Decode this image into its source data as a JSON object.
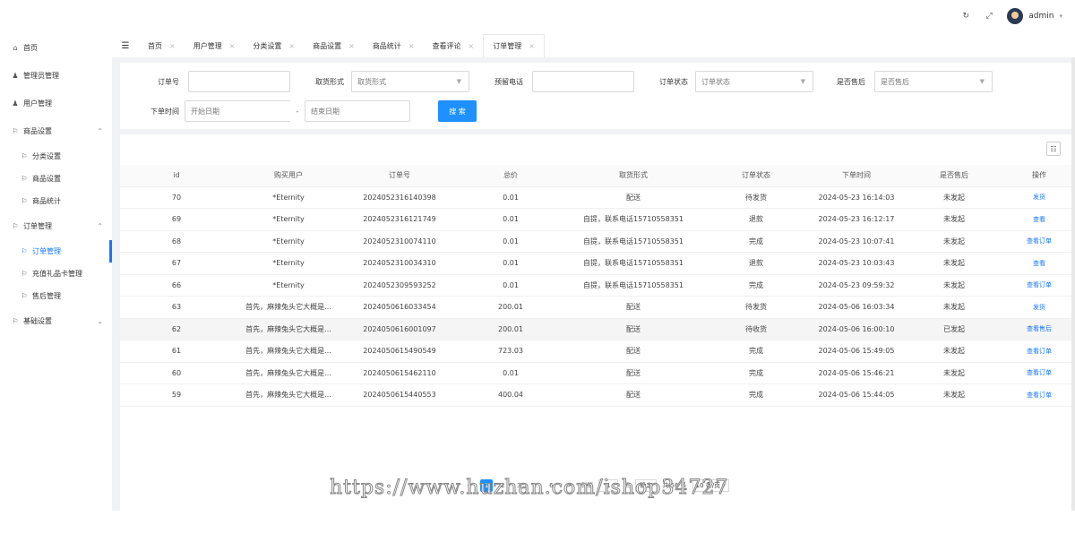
{
  "header": {
    "refresh_icon": "refresh-icon",
    "fullscreen_icon": "fullscreen-icon",
    "username": "admin"
  },
  "sidebar": {
    "items": [
      {
        "label": "首页",
        "icon": "home-icon"
      },
      {
        "label": "管理员管理",
        "icon": "users-icon"
      },
      {
        "label": "用户管理",
        "icon": "users-icon"
      },
      {
        "label": "商品设置",
        "icon": "flag-icon",
        "expanded": true
      },
      {
        "label": "分类设置",
        "icon": "flag-icon",
        "sub": true
      },
      {
        "label": "商品设置",
        "icon": "flag-icon",
        "sub": true
      },
      {
        "label": "商品统计",
        "icon": "flag-icon",
        "sub": true
      },
      {
        "label": "订单管理",
        "icon": "flag-icon",
        "expanded": true
      },
      {
        "label": "订单管理",
        "icon": "flag-icon",
        "sub": true,
        "active": true
      },
      {
        "label": "充值礼品卡管理",
        "icon": "flag-icon",
        "sub": true
      },
      {
        "label": "售后管理",
        "icon": "flag-icon",
        "sub": true
      },
      {
        "label": "基础设置",
        "icon": "flag-icon",
        "expanded": false
      }
    ]
  },
  "tabs": [
    {
      "label": "首页"
    },
    {
      "label": "用户管理"
    },
    {
      "label": "分类设置"
    },
    {
      "label": "商品设置"
    },
    {
      "label": "商品统计"
    },
    {
      "label": "查看评论"
    },
    {
      "label": "订单管理",
      "active": true
    }
  ],
  "search": {
    "order_no_label": "订单号",
    "order_no_value": "",
    "pickup_label": "取货形式",
    "pickup_placeholder": "取货形式",
    "phone_label": "预留电话",
    "phone_value": "",
    "status_label": "订单状态",
    "status_placeholder": "订单状态",
    "aftersale_label": "是否售后",
    "aftersale_placeholder": "是否售后",
    "time_label": "下单时间",
    "start_placeholder": "开始日期",
    "range_sep": "-",
    "end_placeholder": "结束日期",
    "search_button": "搜 索"
  },
  "table": {
    "columns": [
      "id",
      "购买用户",
      "订单号",
      "总价",
      "取货形式",
      "订单状态",
      "下单时间",
      "是否售后",
      "操作"
    ],
    "rows": [
      [
        "70",
        "*Eternity",
        "2024052316140398",
        "0.01",
        "配送",
        "待发货",
        "2024-05-23 16:14:03",
        "未发起",
        "发货"
      ],
      [
        "69",
        "*Eternity",
        "2024052316121749",
        "0.01",
        "自提，联系电话15710558351",
        "退款",
        "2024-05-23 16:12:17",
        "未发起",
        "查看"
      ],
      [
        "68",
        "*Eternity",
        "2024052310074110",
        "0.01",
        "自提，联系电话15710558351",
        "完成",
        "2024-05-23 10:07:41",
        "未发起",
        "查看订单"
      ],
      [
        "67",
        "*Eternity",
        "2024052310034310",
        "0.01",
        "自提，联系电话15710558351",
        "退款",
        "2024-05-23 10:03:43",
        "未发起",
        "查看"
      ],
      [
        "66",
        "*Eternity",
        "2024052309593252",
        "0.01",
        "自提，联系电话15710558351",
        "完成",
        "2024-05-23 09:59:32",
        "未发起",
        "查看订单"
      ],
      [
        "63",
        "首先，麻辣兔头它大概是...",
        "2024050616033454",
        "200.01",
        "配送",
        "待发货",
        "2024-05-06 16:03:34",
        "未发起",
        "发货"
      ],
      [
        "62",
        "首先，麻辣兔头它大概是...",
        "2024050616001097",
        "200.01",
        "配送",
        "待收货",
        "2024-05-06 16:00:10",
        "已发起",
        "查看售后"
      ],
      [
        "61",
        "首先，麻辣兔头它大概是...",
        "2024050615490549",
        "723.03",
        "配送",
        "完成",
        "2024-05-06 15:49:05",
        "未发起",
        "查看订单"
      ],
      [
        "60",
        "首先，麻辣兔头它大概是...",
        "2024050615462110",
        "0.01",
        "配送",
        "完成",
        "2024-05-06 15:46:21",
        "未发起",
        "查看订单"
      ],
      [
        "59",
        "首先，麻辣兔头它大概是...",
        "2024050615440553",
        "400.04",
        "配送",
        "完成",
        "2024-05-06 15:44:05",
        "未发起",
        "查看订单"
      ]
    ],
    "highlighted_row": 6
  },
  "pagination": {
    "prev": "<",
    "pages": [
      "1",
      "2",
      "3",
      "...",
      "6"
    ],
    "current": "1",
    "next": ">",
    "goto_label": "到第",
    "goto_value": "1",
    "page_unit": "页",
    "confirm": "确定",
    "total": "共 56 条",
    "page_size": "10 条/页"
  },
  "watermark": "https://www.huzhan.com/ishop34727",
  "colors": {
    "accent": "#1677ff",
    "content_bg": "#f0f2f5"
  }
}
